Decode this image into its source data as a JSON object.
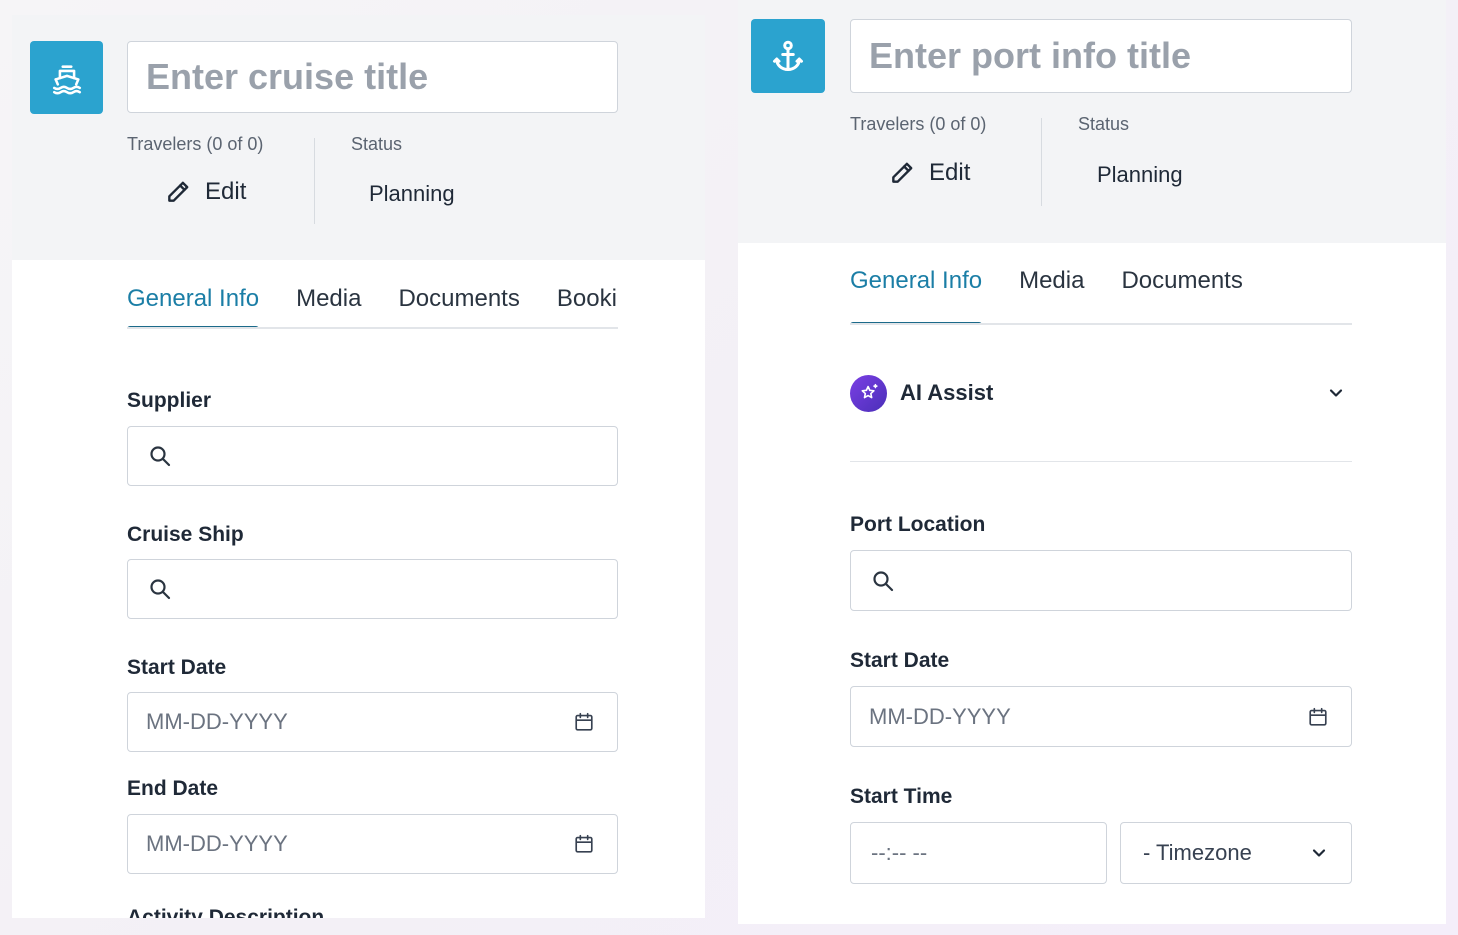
{
  "cruise_panel": {
    "icon": "ship-icon",
    "title_placeholder": "Enter cruise title",
    "travelers_label": "Travelers (0 of 0)",
    "edit_label": "Edit",
    "status_label": "Status",
    "status_value": "Planning",
    "tabs": [
      {
        "label": "General Info",
        "active": true
      },
      {
        "label": "Media",
        "active": false
      },
      {
        "label": "Documents",
        "active": false
      },
      {
        "label": "Booking",
        "active": false
      }
    ],
    "fields": {
      "supplier_label": "Supplier",
      "cruise_ship_label": "Cruise Ship",
      "start_date_label": "Start Date",
      "start_date_placeholder": "MM-DD-YYYY",
      "end_date_label": "End Date",
      "end_date_placeholder": "MM-DD-YYYY",
      "activity_description_label": "Activity Description"
    }
  },
  "port_panel": {
    "icon": "anchor-icon",
    "title_placeholder": "Enter port info title",
    "travelers_label": "Travelers (0 of 0)",
    "edit_label": "Edit",
    "status_label": "Status",
    "status_value": "Planning",
    "tabs": [
      {
        "label": "General Info",
        "active": true
      },
      {
        "label": "Media",
        "active": false
      },
      {
        "label": "Documents",
        "active": false
      }
    ],
    "ai_assist_label": "AI Assist",
    "fields": {
      "port_location_label": "Port Location",
      "start_date_label": "Start Date",
      "start_date_placeholder": "MM-DD-YYYY",
      "start_time_label": "Start Time",
      "start_time_placeholder": "--:-- --",
      "timezone_value": "- Timezone"
    }
  },
  "colors": {
    "accent": "#2ba3cf",
    "tab_active": "#1b7ea6",
    "tab_underline": "#1b6a8a",
    "ai_gradient_start": "#7b3fe4",
    "ai_gradient_end": "#4a2fb8"
  }
}
